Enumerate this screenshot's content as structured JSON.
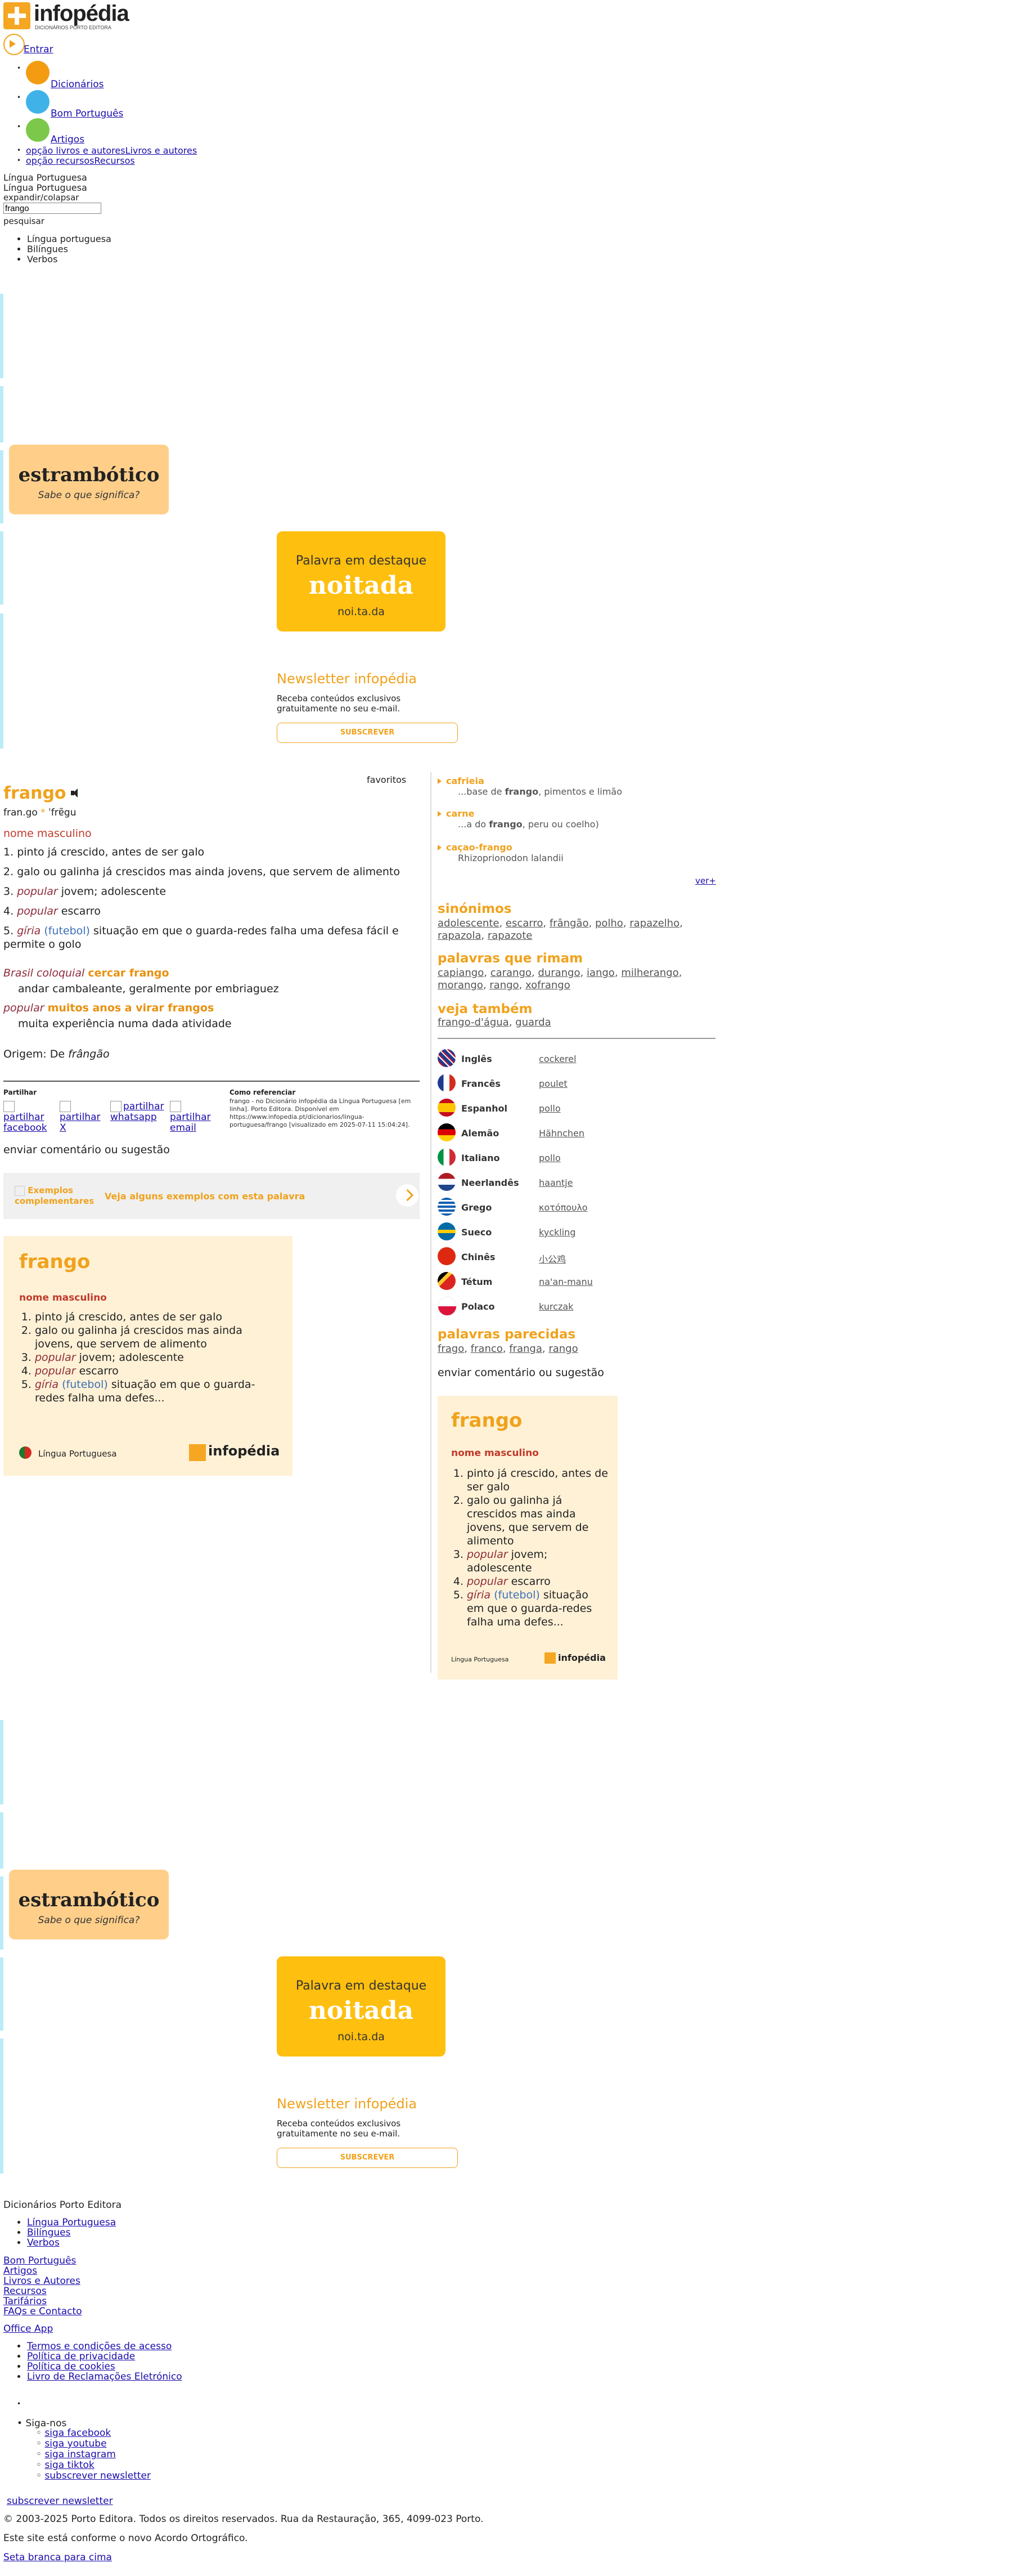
{
  "header": {
    "logo_text": "infopédia",
    "logo_sub": "DICIONÁRIOS PORTO EDITORA",
    "login_label": "Entrar",
    "nav": [
      {
        "label": "Dicionários",
        "color": "#f39c12"
      },
      {
        "label": "Bom Português",
        "color": "#3fb3e8"
      },
      {
        "label": "Artigos",
        "color": "#7cc84a"
      }
    ],
    "opt_books_alt": "opção livros e autores",
    "opt_books": "Livros e autores",
    "opt_res_alt": "opção recursos",
    "opt_res": "Recursos",
    "dict_label_1": "Língua Portuguesa",
    "dict_label_2": "Língua Portuguesa",
    "expand_alt": "expandir/colapsar",
    "search_value": "frango",
    "search_alt": "pesquisar",
    "dict_options": [
      "Língua portuguesa",
      "Bilíngues",
      "Verbos"
    ]
  },
  "banners": {
    "word_challenge": "estrambótico",
    "word_challenge_sub": "Sabe o que significa?",
    "highlight_title": "Palavra em destaque",
    "highlight_word": "noitada",
    "highlight_phon": "noi.ta.da",
    "newsletter_title": "Newsletter infopédia",
    "newsletter_desc_1": "Receba conteúdos exclusivos",
    "newsletter_desc_2": "gratuitamente no seu e-mail.",
    "newsletter_btn": "SUBSCREVER"
  },
  "entry": {
    "favorites_alt": "favoritos",
    "headword": "frango",
    "syllables": "fran.go",
    "phonetic": "ˈfrɐ̃gu",
    "gram": "nome masculino",
    "defs": [
      {
        "num": "1.",
        "tag": "",
        "domain": "",
        "text": "pinto já crescido, antes de ser galo"
      },
      {
        "num": "2.",
        "tag": "",
        "domain": "",
        "text": "galo ou galinha já crescidos mas ainda jovens, que servem de alimento"
      },
      {
        "num": "3.",
        "tag": "popular",
        "domain": "",
        "text": "jovem; adolescente"
      },
      {
        "num": "4.",
        "tag": "popular",
        "domain": "",
        "text": "escarro"
      },
      {
        "num": "5.",
        "tag": "gíria",
        "domain": "(futebol)",
        "text": "situação em que o guarda-redes falha uma defesa fácil e permite o golo"
      }
    ],
    "expr1_tag": "Brasil coloquial",
    "expr1_head": "cercar frango",
    "expr1_def": "andar cambaleante, geralmente por embriaguez",
    "expr2_tag": "popular",
    "expr2_head": "muitos anos a virar frangos",
    "expr2_def": "muita experiência numa dada atividade",
    "origin_label": "Origem: De",
    "origin_word": "frângão",
    "share_title": "Partilhar",
    "share_links": [
      {
        "label": "partilhar facebook"
      },
      {
        "label": "partilhar X"
      },
      {
        "label": "partilhar whatsapp"
      },
      {
        "label": "partilhar email"
      }
    ],
    "cite_title": "Como referenciar",
    "cite_text": "frango - no Dicionário infopédia da Língua Portuguesa [em linha]. Porto Editora. Disponível em https://www.infopedia.pt/dicionarios/lingua-portuguesa/frango [visualizado em 2025-07-11 15:04:24].",
    "comment": "enviar comentário ou sugestão",
    "examples_label": "Exemplos complementares",
    "examples_link": "Veja alguns exemplos com esta palavra"
  },
  "card": {
    "headword": "frango",
    "gram": "nome masculino",
    "items": [
      {
        "tag": "",
        "domain": "",
        "text": "pinto já crescido, antes de ser galo"
      },
      {
        "tag": "",
        "domain": "",
        "text": "galo ou galinha já crescidos mas ainda jovens, que servem de alimento"
      },
      {
        "tag": "popular",
        "domain": "",
        "text": "jovem; adolescente"
      },
      {
        "tag": "popular",
        "domain": "",
        "text": "escarro"
      },
      {
        "tag": "gíria",
        "domain": "(futebol)",
        "text": "situação em que o guarda-redes falha uma defes..."
      }
    ],
    "footer_lang": "Língua Portuguesa",
    "footer_brand": "infopédia"
  },
  "sidebar": {
    "related": [
      {
        "title": "cafrieia",
        "pre": "...base de ",
        "bold": "frango",
        "post": ", pimentos e limão"
      },
      {
        "title": "carne",
        "pre": "...a do ",
        "bold": "frango",
        "post": ", peru ou coelho)"
      },
      {
        "title": "caçao-frango",
        "pre": "Rhizoprionodon lalandii",
        "bold": "",
        "post": ""
      }
    ],
    "more": "ver+",
    "synonyms_title": "sinónimos",
    "synonyms": [
      "adolescente",
      "escarro",
      "frângão",
      "polho",
      "rapazelho",
      "rapazola",
      "rapazote"
    ],
    "rhymes_title": "palavras que rimam",
    "rhymes": [
      "capiango",
      "carango",
      "durango",
      "iango",
      "milherango",
      "morango",
      "rango",
      "xofrango"
    ],
    "see_also_title": "veja também",
    "see_also": [
      "frango-d'água",
      "guarda"
    ],
    "translations": [
      {
        "lang": "Inglês",
        "word": "cockerel",
        "flag": "gb"
      },
      {
        "lang": "Francês",
        "word": "poulet",
        "flag": "fr"
      },
      {
        "lang": "Espanhol",
        "word": "pollo",
        "flag": "es"
      },
      {
        "lang": "Alemão",
        "word": "Hähnchen",
        "flag": "de"
      },
      {
        "lang": "Italiano",
        "word": "pollo",
        "flag": "it"
      },
      {
        "lang": "Neerlandês",
        "word": "haantje",
        "flag": "nl"
      },
      {
        "lang": "Grego",
        "word": "κοτόπουλο",
        "flag": "gr"
      },
      {
        "lang": "Sueco",
        "word": "kyckling",
        "flag": "se"
      },
      {
        "lang": "Chinês",
        "word": "小公鸡",
        "flag": "cn"
      },
      {
        "lang": "Tétum",
        "word": "na'an-manu",
        "flag": "tl"
      },
      {
        "lang": "Polaco",
        "word": "kurczak",
        "flag": "pl"
      }
    ],
    "similar_title": "palavras parecidas",
    "similar": [
      "frago",
      "franco",
      "franga",
      "rango"
    ],
    "comment": "enviar comentário ou sugestão"
  },
  "footer": {
    "title": "Dicionários Porto Editora",
    "dict_links": [
      "Língua Portuguesa",
      "Bilíngues",
      "Verbos"
    ],
    "links": [
      "Bom Português",
      "Artigos",
      "Livros e Autores",
      "Recursos",
      "Tarifários",
      "FAQs e Contacto"
    ],
    "office": "Office App",
    "legal": [
      "Termos e condições de acesso",
      "Política de privacidade",
      "Política de cookies",
      "Livro de Reclamações Eletrónico"
    ],
    "follow": "Siga-nos",
    "social": [
      "siga facebook",
      "siga youtube",
      "siga instagram",
      "siga tiktok"
    ],
    "newsletter": "subscrever newsletter",
    "newsletter2": "subscrever newsletter",
    "copyright": "© 2003-2025 Porto Editora. Todos os direitos reservados. Rua da Restauração, 365, 4099-023 Porto.",
    "ao": "Este site está conforme o novo Acordo Ortográfico.",
    "top": "Seta branca para cima"
  }
}
